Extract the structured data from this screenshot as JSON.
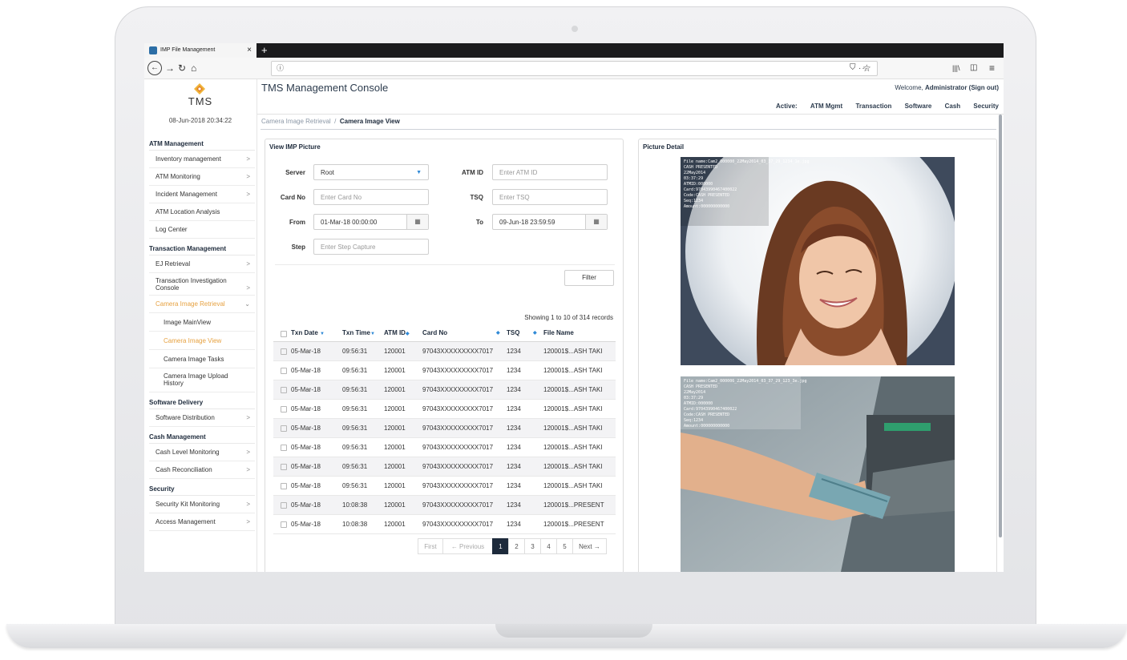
{
  "browser": {
    "tab_title": "IMP File Management",
    "tab_close": "×",
    "new_tab": "+",
    "url_info": "ⓘ",
    "url_actions": "···"
  },
  "sidebar": {
    "logo_text": "TMS",
    "datetime": "08-Jun-2018 20:34:22",
    "sections": [
      {
        "title": "ATM Management",
        "items": [
          {
            "label": "Inventory management",
            "chev": ">"
          },
          {
            "label": "ATM Monitoring",
            "chev": ">"
          },
          {
            "label": "Incident Management",
            "chev": ">"
          },
          {
            "label": "ATM Location Analysis",
            "chev": ""
          },
          {
            "label": "Log Center",
            "chev": ""
          }
        ]
      },
      {
        "title": "Transaction Management",
        "items": [
          {
            "label": "EJ Retrieval",
            "chev": ">"
          },
          {
            "label": "Transaction Investigation Console",
            "chev": ">"
          },
          {
            "label": "Camera Image Retrieval",
            "chev": "⌄",
            "active": true
          },
          {
            "label": "Image MainView",
            "chev": "",
            "sub": true
          },
          {
            "label": "Camera Image View",
            "chev": "",
            "sub": true,
            "active": true
          },
          {
            "label": "Camera Image Tasks",
            "chev": "",
            "sub": true
          },
          {
            "label": "Camera Image Upload History",
            "chev": "",
            "sub": true
          }
        ]
      },
      {
        "title": "Software Delivery",
        "items": [
          {
            "label": "Software Distribution",
            "chev": ">"
          }
        ]
      },
      {
        "title": "Cash Management",
        "items": [
          {
            "label": "Cash Level Monitoring",
            "chev": ">"
          },
          {
            "label": "Cash Reconciliation",
            "chev": ">"
          }
        ]
      },
      {
        "title": "Security",
        "items": [
          {
            "label": "Security Kit Monitoring",
            "chev": ">"
          },
          {
            "label": "Access Management",
            "chev": ">"
          }
        ]
      }
    ]
  },
  "header": {
    "title": "TMS Management Console",
    "welcome_prefix": "Welcome, ",
    "user": "Administrator",
    "sign_out": "(Sign out)",
    "active_label": "Active:",
    "nav": [
      "ATM Mgmt",
      "Transaction",
      "Software",
      "Cash",
      "Security"
    ]
  },
  "breadcrumb": {
    "parent": "Camera Image Retrieval",
    "sep": "/",
    "current": "Camera Image View"
  },
  "form": {
    "title": "View IMP Picture",
    "server_label": "Server",
    "server_value": "Root",
    "atmid_label": "ATM ID",
    "atmid_placeholder": "Enter ATM ID",
    "cardno_label": "Card No",
    "cardno_placeholder": "Enter Card No",
    "tsq_label": "TSQ",
    "tsq_placeholder": "Enter TSQ",
    "from_label": "From",
    "from_value": "01-Mar-18 00:00:00",
    "to_label": "To",
    "to_value": "09-Jun-18 23:59:59",
    "step_label": "Step",
    "step_placeholder": "Enter Step Capture",
    "filter_button": "Filter"
  },
  "table": {
    "showing": "Showing 1 to 10 of 314 records",
    "columns": [
      "Txn Date",
      "Txn Time",
      "ATM ID",
      "Card No",
      "TSQ",
      "File Name"
    ],
    "rows": [
      [
        "05-Mar-18",
        "09:56:31",
        "120001",
        "97043XXXXXXXXX7017",
        "1234",
        "120001$...ASH TAKI"
      ],
      [
        "05-Mar-18",
        "09:56:31",
        "120001",
        "97043XXXXXXXXX7017",
        "1234",
        "120001$...ASH TAKI"
      ],
      [
        "05-Mar-18",
        "09:56:31",
        "120001",
        "97043XXXXXXXXX7017",
        "1234",
        "120001$...ASH TAKI"
      ],
      [
        "05-Mar-18",
        "09:56:31",
        "120001",
        "97043XXXXXXXXX7017",
        "1234",
        "120001$...ASH TAKI"
      ],
      [
        "05-Mar-18",
        "09:56:31",
        "120001",
        "97043XXXXXXXXX7017",
        "1234",
        "120001$...ASH TAKI"
      ],
      [
        "05-Mar-18",
        "09:56:31",
        "120001",
        "97043XXXXXXXXX7017",
        "1234",
        "120001$...ASH TAKI"
      ],
      [
        "05-Mar-18",
        "09:56:31",
        "120001",
        "97043XXXXXXXXX7017",
        "1234",
        "120001$...ASH TAKI"
      ],
      [
        "05-Mar-18",
        "09:56:31",
        "120001",
        "97043XXXXXXXXX7017",
        "1234",
        "120001$...ASH TAKI"
      ],
      [
        "05-Mar-18",
        "10:08:38",
        "120001",
        "97043XXXXXXXXX7017",
        "1234",
        "120001$...PRESENT"
      ],
      [
        "05-Mar-18",
        "10:08:38",
        "120001",
        "97043XXXXXXXXX7017",
        "1234",
        "120001$...PRESENT"
      ]
    ]
  },
  "pagination": {
    "first": "First",
    "prev": "← Previous",
    "pages": [
      "1",
      "2",
      "3",
      "4",
      "5"
    ],
    "next": "Next →",
    "current": "1"
  },
  "detail": {
    "title": "Picture Detail",
    "overlay1": [
      "File name:Cam2_000000_22May2014_03_37_29_1234_1e.jpg",
      "CASH PRESENTED",
      "22May2014",
      "03:37:29",
      "ATMID:000000",
      "Card:97043990467400022",
      "Code:CASH PRESENTED",
      "Seq:1234",
      "Amount:000000000000"
    ],
    "overlay2": [
      "File name:Cam2_000006_22May2014_03_37_29_123_3e.jpg",
      "CASH PRESENTED",
      "22May2014",
      "03:37:29",
      "ATMID:000000",
      "Card:97043990467400022",
      "Code:CASH PRESENTED",
      "Seq:1234",
      "Amount:000000000000"
    ]
  },
  "colors": {
    "accent": "#e6a140",
    "navy": "#1d2a3b",
    "link": "#2f89d6"
  }
}
